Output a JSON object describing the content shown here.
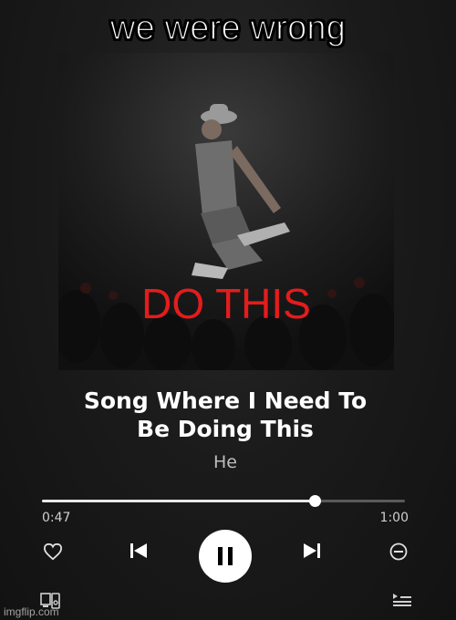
{
  "meme": {
    "caption": "we were wrong"
  },
  "album_art": {
    "overlay_text": "DO THIS",
    "overlay_color": "#e41c1c"
  },
  "track": {
    "title_line1": "Song Where I Need To",
    "title_line2": "Be Doing This",
    "artist": "He"
  },
  "playback": {
    "elapsed": "0:47",
    "total": "1:00",
    "progress_fraction": 0.75,
    "state": "playing"
  },
  "controls": {
    "like_icon": "heart-icon",
    "previous_icon": "skip-previous-icon",
    "play_pause_icon": "pause-icon",
    "next_icon": "skip-next-icon",
    "remove_icon": "minus-circle-icon",
    "devices_icon": "devices-icon",
    "queue_icon": "queue-icon"
  },
  "watermark": {
    "text": "imgflip.com"
  },
  "colors": {
    "background": "#141414",
    "text_primary": "#ffffff",
    "text_secondary": "#bdbdbd",
    "progress_fill": "#e8e8e8",
    "progress_track": "#5a5a5a"
  }
}
